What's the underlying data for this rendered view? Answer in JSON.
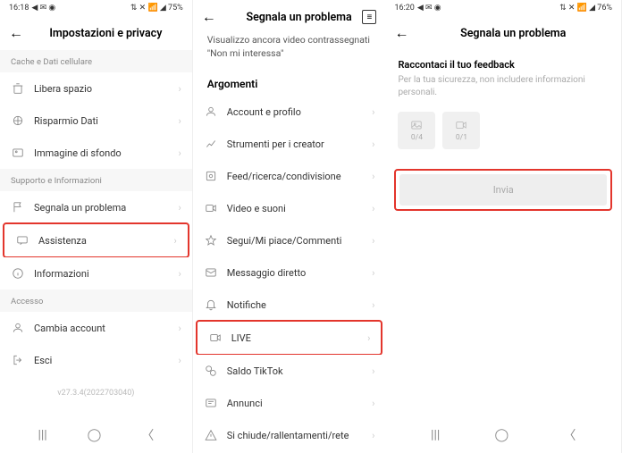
{
  "status": {
    "time": "16:18",
    "time3": "16:20",
    "icons_left": "◀ ✉ ◉",
    "icons_right": "⇅ ✕ 📶 ◢ 75%",
    "icons_right3": "⇅ ✕ 📶 ◢ 76%"
  },
  "panel1": {
    "title": "Impostazioni e privacy",
    "section1": "Cache e Dati cellulare",
    "rows1": [
      {
        "icon": "trash",
        "label": "Libera spazio"
      },
      {
        "icon": "data",
        "label": "Risparmio Dati"
      },
      {
        "icon": "image",
        "label": "Immagine di sfondo"
      }
    ],
    "section2": "Supporto e Informazioni",
    "rows2": [
      {
        "icon": "flag",
        "label": "Segnala un problema"
      },
      {
        "icon": "chat",
        "label": "Assistenza",
        "hl": true
      },
      {
        "icon": "info",
        "label": "Informazioni"
      }
    ],
    "section3": "Accesso",
    "rows3": [
      {
        "icon": "switch",
        "label": "Cambia account"
      },
      {
        "icon": "logout",
        "label": "Esci"
      }
    ],
    "version": "v27.3.4(2022703040)"
  },
  "panel2": {
    "title": "Segnala un problema",
    "subtitle": "Visualizzo ancora video contrassegnati \"Non mi interessa\"",
    "section": "Argomenti",
    "rows": [
      {
        "icon": "account",
        "label": "Account e profilo"
      },
      {
        "icon": "chart",
        "label": "Strumenti per i creator"
      },
      {
        "icon": "feed",
        "label": "Feed/ricerca/condivisione"
      },
      {
        "icon": "video",
        "label": "Video e suoni"
      },
      {
        "icon": "star",
        "label": "Segui/Mi piace/Commenti"
      },
      {
        "icon": "message",
        "label": "Messaggio diretto"
      },
      {
        "icon": "bell",
        "label": "Notifiche"
      },
      {
        "icon": "live",
        "label": "LIVE",
        "hl": true
      },
      {
        "icon": "wallet",
        "label": "Saldo TikTok"
      },
      {
        "icon": "ads",
        "label": "Annunci"
      },
      {
        "icon": "warn",
        "label": "Si chiude/rallentamenti/rete"
      }
    ]
  },
  "panel3": {
    "title": "Segnala un problema",
    "heading": "Raccontaci il tuo feedback",
    "hint": "Per la tua sicurezza, non includere informazioni personali.",
    "img_count": "0/4",
    "vid_count": "0/1",
    "send": "Invia"
  }
}
